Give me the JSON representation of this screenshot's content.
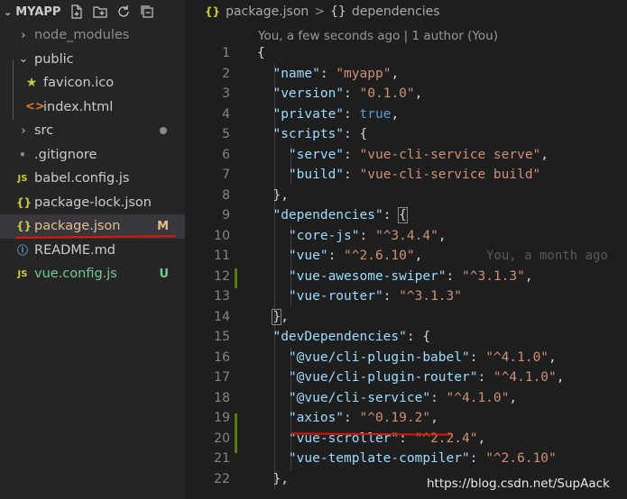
{
  "sidebar": {
    "title": "MYAPP",
    "actions": [
      "new-file-icon",
      "new-folder-icon",
      "refresh-icon",
      "collapse-all-icon"
    ],
    "items": [
      {
        "name": "node_modules",
        "kind": "folder",
        "expanded": false,
        "dim": true
      },
      {
        "name": "public",
        "kind": "folder",
        "expanded": true
      },
      {
        "name": "favicon.ico",
        "kind": "file",
        "icon": "star-icon"
      },
      {
        "name": "index.html",
        "kind": "file",
        "icon": "html-icon"
      },
      {
        "name": "src",
        "kind": "folder",
        "expanded": false,
        "modified_dot": true
      },
      {
        "name": ".gitignore",
        "kind": "file"
      },
      {
        "name": "babel.config.js",
        "kind": "file",
        "icon": "js-icon"
      },
      {
        "name": "package-lock.json",
        "kind": "file",
        "icon": "json-icon"
      },
      {
        "name": "package.json",
        "kind": "file",
        "icon": "json-icon",
        "badge": "M",
        "selected": true
      },
      {
        "name": "README.md",
        "kind": "file",
        "icon": "info-icon"
      },
      {
        "name": "vue.config.js",
        "kind": "file",
        "icon": "js-icon",
        "badge": "U"
      }
    ],
    "icon_glyphs": {
      "js": "JS",
      "json": "{}"
    }
  },
  "breadcrumb": {
    "file": "package.json",
    "symbol": "dependencies",
    "icon_text": "{}",
    "sep": ">"
  },
  "codelens": "You, a few seconds ago | 1 author (You)",
  "blame_annotation": "You, a month ago",
  "watermark": "https://blog.csdn.net/SupAack",
  "colors": {
    "added": "#73c991",
    "modified": "#e2c08d",
    "underline": "#e51400"
  },
  "code": [
    "{",
    "  \"name\": \"myapp\",",
    "  \"version\": \"0.1.0\",",
    "  \"private\": true,",
    "  \"scripts\": {",
    "    \"serve\": \"vue-cli-service serve\",",
    "    \"build\": \"vue-cli-service build\"",
    "  },",
    "  \"dependencies\": {",
    "    \"core-js\": \"^3.4.4\",",
    "    \"vue\": \"^2.6.10\",",
    "    \"vue-awesome-swiper\": \"^3.1.3\",",
    "    \"vue-router\": \"^3.1.3\"",
    "  },",
    "  \"devDependencies\": {",
    "    \"@vue/cli-plugin-babel\": \"^4.1.0\",",
    "    \"@vue/cli-plugin-router\": \"^4.1.0\",",
    "    \"@vue/cli-service\": \"^4.1.0\",",
    "    \"axios\": \"^0.19.2\",",
    "    \"vue-scroller\": \"^2.2.4\",",
    "    \"vue-template-compiler\": \"^2.6.10\"",
    "  },"
  ]
}
